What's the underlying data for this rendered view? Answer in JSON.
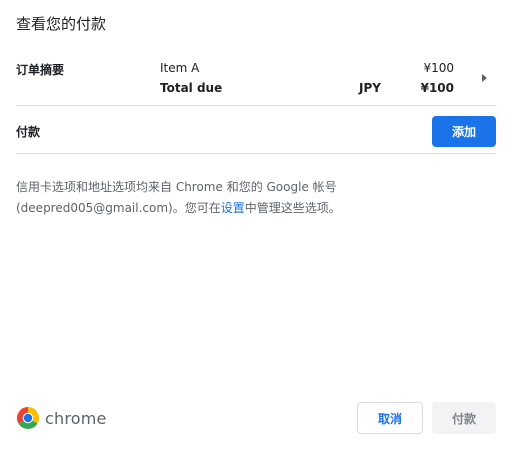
{
  "dialog": {
    "title": "查看您的付款"
  },
  "order_summary": {
    "label": "订单摘要",
    "item_name": "Item A",
    "item_price": "¥100",
    "total_label": "Total due",
    "total_currency": "JPY",
    "total_amount": "¥100",
    "expand_icon": "triangle-right-icon"
  },
  "payment": {
    "label": "付款",
    "add_button_label": "添加"
  },
  "info": {
    "line1": "信用卡选项和地址选项均来自 Chrome 和您的 Google 帐号",
    "line2_prefix": "(deepred005@gmail.com)。您可在",
    "settings_link": "设置",
    "line2_suffix": "中管理这些选项。"
  },
  "footer": {
    "brand_icon": "chrome-logo-icon",
    "brand_text": "chrome",
    "cancel_label": "取消",
    "pay_label": "付款"
  },
  "colors": {
    "accent": "#1a73e8",
    "divider": "#dadce0",
    "disabled_bg": "#f1f3f4",
    "disabled_text": "#80868b"
  }
}
